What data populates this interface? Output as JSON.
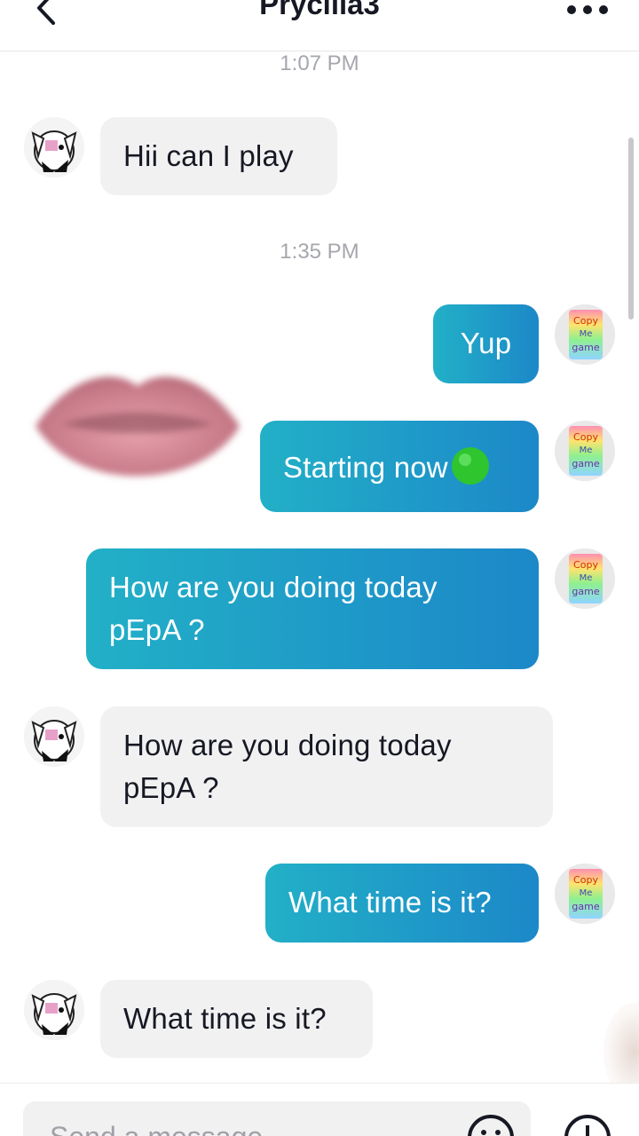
{
  "header": {
    "title": "Prycilla3",
    "back_icon": "chevron-left-icon",
    "more_icon": "more-horizontal-icon"
  },
  "messages": [
    {
      "type": "timestamp",
      "text": "1:07 PM"
    },
    {
      "type": "incoming",
      "text": "Hii can I play"
    },
    {
      "type": "timestamp",
      "text": "1:35 PM"
    },
    {
      "type": "outgoing",
      "text": "Yup"
    },
    {
      "type": "outgoing",
      "text": "Starting now",
      "emoji": "green-circle-emoji"
    },
    {
      "type": "outgoing",
      "text": "How are you doing today pEpA ?"
    },
    {
      "type": "incoming",
      "text": "How are you doing today pEpA ?"
    },
    {
      "type": "outgoing",
      "text": "What time is it?"
    },
    {
      "type": "incoming",
      "text": "What time is it?"
    }
  ],
  "avatars": {
    "other_user": "dog-avatar",
    "self_text": [
      "Copy",
      "Me",
      "game"
    ]
  },
  "composer": {
    "placeholder": "Send a message...",
    "emoji_icon": "emoji-icon",
    "add_icon": "plus-icon"
  },
  "colors": {
    "outgoing_start": "#22b0c7",
    "outgoing_end": "#1c88c8",
    "incoming_bg": "#f1f1f2",
    "timestamp": "#a5a7ad"
  }
}
